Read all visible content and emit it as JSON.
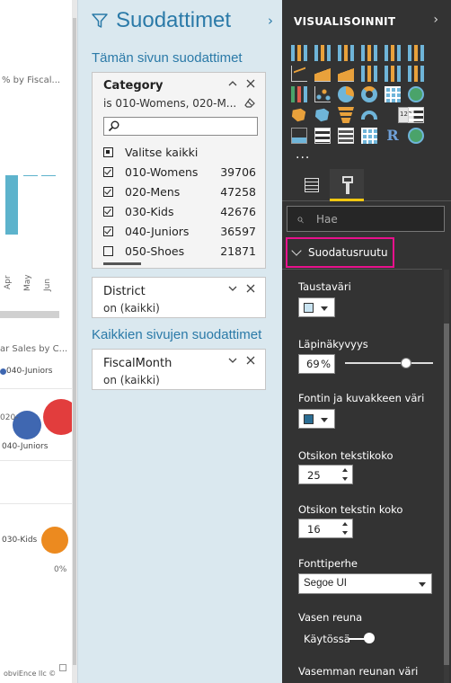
{
  "canvas": {
    "chart1_title_fragment": "% by Fiscal...",
    "month_labels": [
      "Apr",
      "May",
      "Jun"
    ],
    "chart2_title_fragment": "ar Sales by C...",
    "legend_item": "040-Juniors",
    "bubble_labels": [
      "020-",
      "040-Juniors",
      "030-Kids"
    ],
    "axis_value": "0%",
    "footer_fragment": "obviEnce llc ©",
    "colors": {
      "bar": "#5db3cc",
      "bubble_blue": "#3f67b1",
      "bubble_red": "#e23d3d",
      "bubble_orange": "#ec8a1f"
    }
  },
  "filters": {
    "title": "Suodattimet",
    "collapse_icon": "chevron-right-icon",
    "page_section": "Tämän sivun suodattimet",
    "all_pages_section": "Kaikkien sivujen suodattimet",
    "category_card": {
      "title": "Category",
      "summary": "is 010-Womens, 020-M...",
      "search_placeholder": "",
      "select_all": "Valitse kaikki",
      "items": [
        {
          "label": "010-Womens",
          "count": "39706",
          "checked": true
        },
        {
          "label": "020-Mens",
          "count": "47258",
          "checked": true
        },
        {
          "label": "030-Kids",
          "count": "42676",
          "checked": true
        },
        {
          "label": "040-Juniors",
          "count": "36597",
          "checked": true
        },
        {
          "label": "050-Shoes",
          "count": "21871",
          "checked": false
        }
      ]
    },
    "district_card": {
      "title": "District",
      "summary": "on (kaikki)"
    },
    "fiscalmonth_card": {
      "title": "FiscalMonth",
      "summary": "on (kaikki)"
    }
  },
  "viz": {
    "title": "VISUALISOINNIT",
    "more": "...",
    "search_placeholder": "Hae",
    "section": "Suodatusruutu",
    "background_color_label": "Taustaväri",
    "background_color": "#c9e4f2",
    "transparency_label": "Läpinäkyvyys",
    "transparency_value": "69",
    "transparency_unit": "%",
    "transparency_percent": 69,
    "font_icon_color_label": "Fontin ja kuvakkeen väri",
    "font_icon_color": "#2b6d93",
    "header_text_size_label": "Otsikon tekstikoko",
    "header_text_size": "25",
    "title_text_size_label": "Otsikon tekstin koko",
    "title_text_size": "16",
    "font_family_label": "Fonttiperhe",
    "font_family": "Segoe UI",
    "left_border_label": "Vasen reuna",
    "left_border_state": "Käytössä",
    "left_border_color_label": "Vasemman reunan väri",
    "highlight_color": "#e8118c",
    "accent_color": "#f2c811"
  }
}
